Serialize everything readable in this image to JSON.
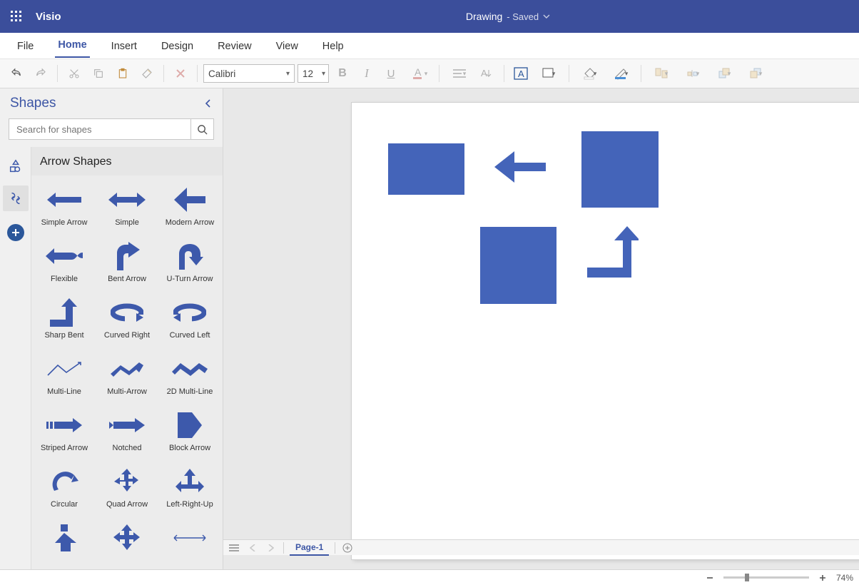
{
  "titlebar": {
    "app": "Visio",
    "doc": "Drawing",
    "saved": " -  Saved"
  },
  "menu": {
    "items": [
      "File",
      "Home",
      "Insert",
      "Design",
      "Review",
      "View",
      "Help"
    ],
    "active": 1
  },
  "ribbon": {
    "font": "Calibri",
    "size": "12"
  },
  "shapes": {
    "title": "Shapes",
    "search_placeholder": "Search for shapes",
    "stencil_title": "Arrow Shapes",
    "items": [
      "Simple Arrow",
      "Simple",
      "Modern Arrow",
      "Flexible",
      "Bent Arrow",
      "U-Turn Arrow",
      "Sharp Bent",
      "Curved Right",
      "Curved Left",
      "Multi-Line",
      "Multi-Arrow",
      "2D Multi-Line",
      "Striped Arrow",
      "Notched",
      "Block Arrow",
      "Circular",
      "Quad Arrow",
      "Left-Right-Up",
      "",
      "",
      ""
    ]
  },
  "pagetabs": {
    "page": "Page-1"
  },
  "status": {
    "zoom": "74%"
  }
}
